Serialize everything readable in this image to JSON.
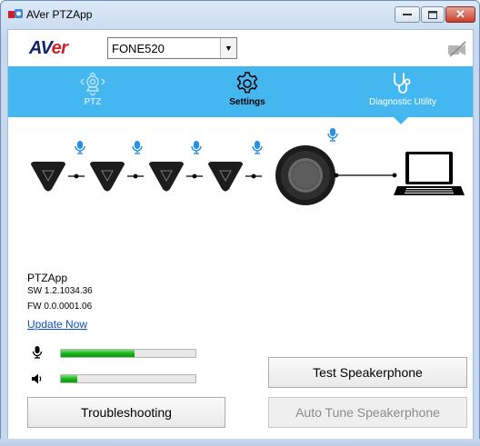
{
  "window": {
    "title": "AVer PTZApp",
    "close_glyph": "✕"
  },
  "header": {
    "logo_main": "AV",
    "logo_accent": "er",
    "device_select": {
      "selected": "FONE520"
    },
    "camera_status_icon": "camera-muted-icon"
  },
  "nav": {
    "items": [
      {
        "label": "PTZ",
        "icon": "ptz-camera-icon",
        "state": "disabled"
      },
      {
        "label": "Settings",
        "icon": "gear-icon",
        "state": "normal"
      },
      {
        "label": "Diagnostic Utility",
        "icon": "stethoscope-icon",
        "state": "active"
      }
    ],
    "bar_color": "#45b7f0"
  },
  "diagram": {
    "mic_count": 4,
    "connected_to": "laptop-icon",
    "mic_icon_color": "#2a8fe6"
  },
  "info": {
    "app_name": "PTZApp",
    "sw_version": "SW 1.2.1034.36",
    "fw_version": "FW 0.0.0001.06",
    "update_link": "Update Now"
  },
  "meters": {
    "microphone": {
      "icon": "microphone-icon",
      "level": 0.55
    },
    "speaker": {
      "icon": "speaker-icon",
      "level": 0.12
    }
  },
  "buttons": {
    "troubleshooting": "Troubleshooting",
    "test_speakerphone": "Test Speakerphone",
    "auto_tune_speakerphone": "Auto Tune Speakerphone"
  }
}
